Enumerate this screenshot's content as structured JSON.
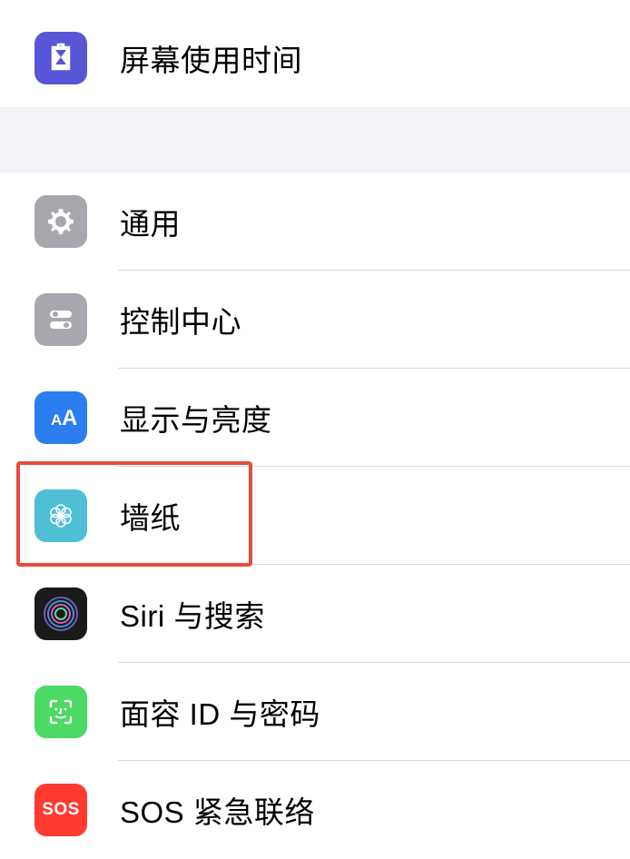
{
  "section1": {
    "items": [
      {
        "label": "屏幕使用时间"
      }
    ]
  },
  "section2": {
    "items": [
      {
        "label": "通用"
      },
      {
        "label": "控制中心"
      },
      {
        "label": "显示与亮度"
      },
      {
        "label": "墙纸"
      },
      {
        "label": "Siri 与搜索"
      },
      {
        "label": "面容 ID 与密码"
      },
      {
        "label": "SOS 紧急联络"
      }
    ]
  },
  "icons": {
    "sos_text": "SOS"
  },
  "highlight": {
    "target": "wallpaper"
  }
}
